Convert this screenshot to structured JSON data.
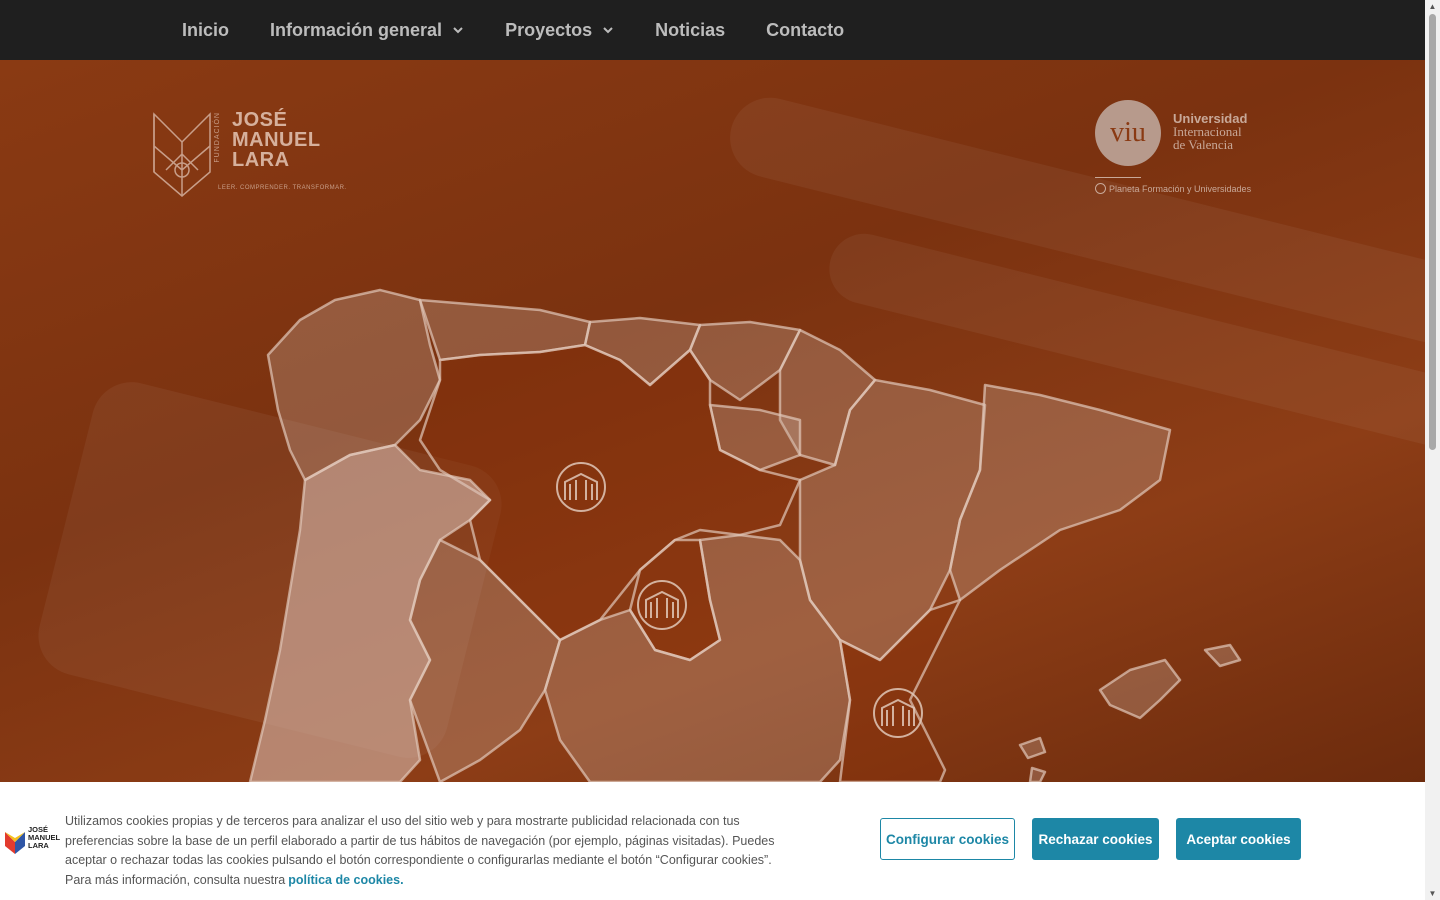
{
  "nav": {
    "items": [
      {
        "label": "Inicio",
        "has_dropdown": false
      },
      {
        "label": "Información general",
        "has_dropdown": true
      },
      {
        "label": "Proyectos",
        "has_dropdown": true
      },
      {
        "label": "Noticias",
        "has_dropdown": false
      },
      {
        "label": "Contacto",
        "has_dropdown": false
      }
    ]
  },
  "hero": {
    "logo_left": {
      "vertical": "FUNDACIÓN",
      "line1": "JOSÉ",
      "line2": "MANUEL",
      "line3": "LARA",
      "tagline": "LEER. COMPRENDER. TRANSFORMAR."
    },
    "logo_right": {
      "mark": "viu",
      "line1": "Universidad",
      "line2": "Internacional",
      "line3": "de Valencia",
      "group": "Planeta Formación y Universidades"
    }
  },
  "cookie": {
    "text": "Utilizamos cookies propias y de terceros para analizar el uso del sitio web y para mostrarte publicidad relacionada con tus preferencias sobre la base de un perfil elaborado a partir de tus hábitos de navegación (por ejemplo, páginas visitadas). Puedes aceptar o rechazar todas las cookies pulsando el botón correspondiente o configurarlas mediante el botón “Configurar cookies”. Para más información, consulta nuestra",
    "link": "política de cookies.",
    "logo_text": [
      "JOSÉ",
      "MANUEL",
      "LARA"
    ],
    "buttons": {
      "configure": "Configurar cookies",
      "reject": "Rechazar cookies",
      "accept": "Aceptar cookies"
    }
  },
  "colors": {
    "nav_bg": "#1f1f1f",
    "hero_bg": "#7b3210",
    "accent": "#1d87a6"
  }
}
